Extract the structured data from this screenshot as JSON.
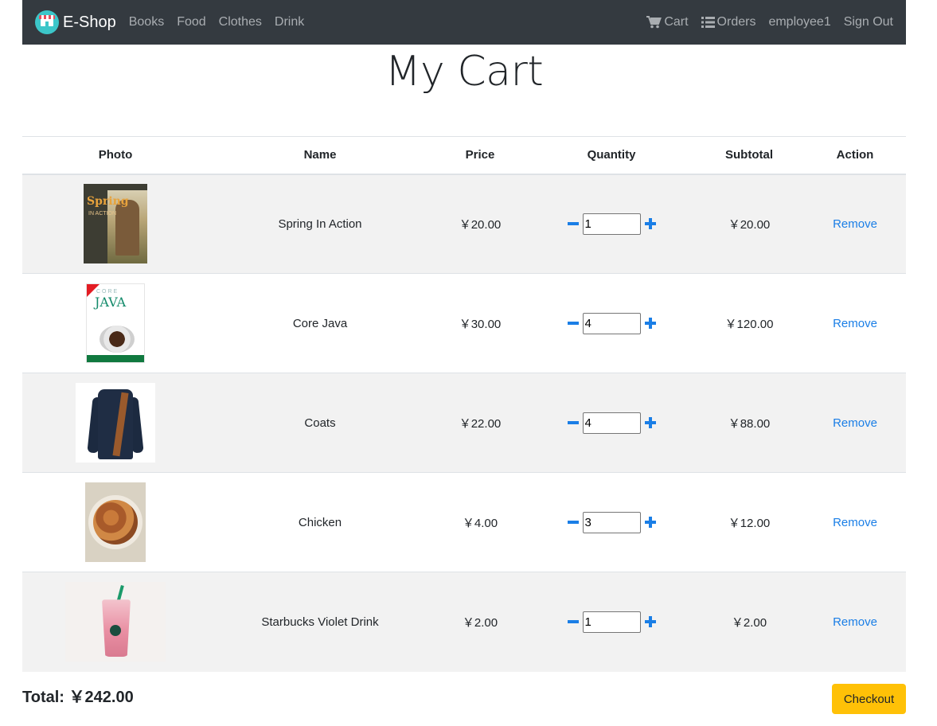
{
  "nav": {
    "brand": "E-Shop",
    "categories": [
      "Books",
      "Food",
      "Clothes",
      "Drink"
    ],
    "cart_label": "Cart",
    "orders_label": "Orders",
    "username": "employee1",
    "signout_label": "Sign Out"
  },
  "page": {
    "title": "My Cart"
  },
  "table": {
    "headers": [
      "Photo",
      "Name",
      "Price",
      "Quantity",
      "Subtotal",
      "Action"
    ],
    "rows": [
      {
        "name": "Spring In Action",
        "price": "￥20.00",
        "quantity": "1",
        "subtotal": "￥20.00",
        "action": "Remove"
      },
      {
        "name": "Core Java",
        "price": "￥30.00",
        "quantity": "4",
        "subtotal": "￥120.00",
        "action": "Remove"
      },
      {
        "name": "Coats",
        "price": "￥22.00",
        "quantity": "4",
        "subtotal": "￥88.00",
        "action": "Remove"
      },
      {
        "name": "Chicken",
        "price": "￥4.00",
        "quantity": "3",
        "subtotal": "￥12.00",
        "action": "Remove"
      },
      {
        "name": "Starbucks Violet Drink",
        "price": "￥2.00",
        "quantity": "1",
        "subtotal": "￥2.00",
        "action": "Remove"
      }
    ]
  },
  "cover_text": {
    "spring_title": "Spring",
    "spring_sub": "IN ACTION",
    "java_core": "CORE",
    "java_title": "JAVA"
  },
  "footer": {
    "total_label": "Total:",
    "total_value": "￥242.00",
    "checkout_label": "Checkout"
  },
  "colors": {
    "navbar_bg": "#343a40",
    "accent_blue": "#1a7ee6",
    "checkout_yellow": "#ffc107",
    "row_stripe": "#f2f2f2"
  }
}
